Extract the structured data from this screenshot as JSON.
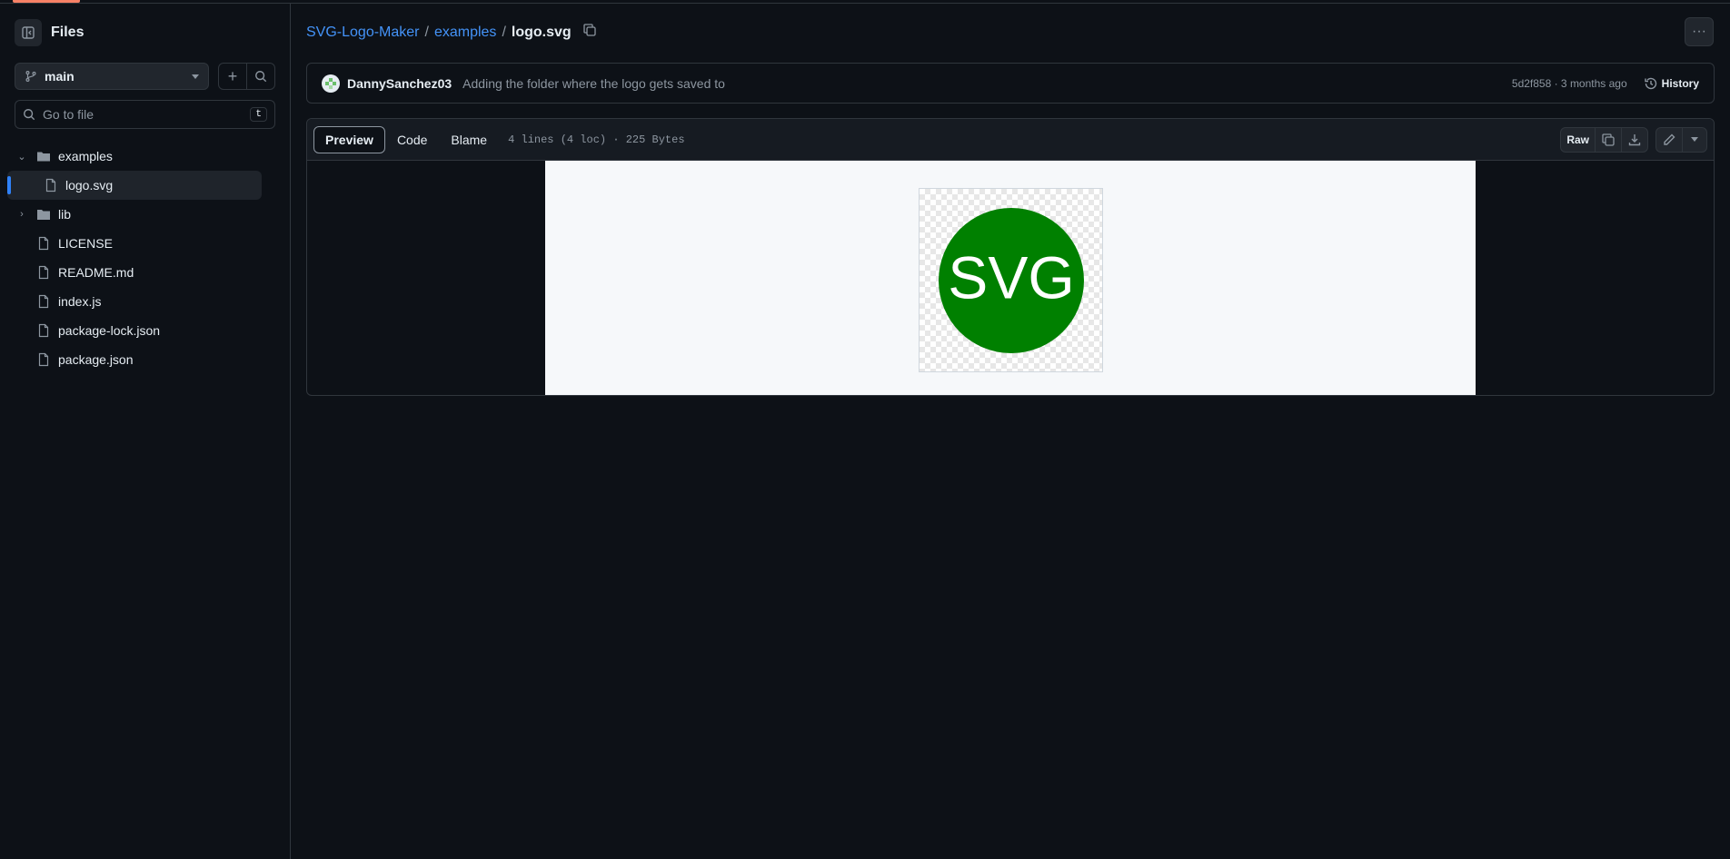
{
  "sidebar": {
    "title": "Files",
    "branch": "main",
    "goto_placeholder": "Go to file",
    "goto_shortcut": "t",
    "tree": [
      {
        "label": "examples",
        "kind": "folder",
        "expanded": true
      },
      {
        "label": "logo.svg",
        "kind": "file",
        "selected": true
      },
      {
        "label": "lib",
        "kind": "folder",
        "expanded": false
      },
      {
        "label": "LICENSE",
        "kind": "file"
      },
      {
        "label": "README.md",
        "kind": "file"
      },
      {
        "label": "index.js",
        "kind": "file"
      },
      {
        "label": "package-lock.json",
        "kind": "file"
      },
      {
        "label": "package.json",
        "kind": "file"
      }
    ]
  },
  "breadcrumb": {
    "repo": "SVG-Logo-Maker",
    "folder": "examples",
    "file": "logo.svg",
    "separator": "/"
  },
  "commit": {
    "author": "DannySanchez03",
    "message": "Adding the folder where the logo gets saved to",
    "meta": "5d2f858 · 3 months ago",
    "history_label": "History"
  },
  "file_view": {
    "tabs": [
      "Preview",
      "Code",
      "Blame"
    ],
    "active_tab": "Preview",
    "info": "4 lines (4 loc) · 225 Bytes",
    "raw_label": "Raw"
  },
  "logo": {
    "text": "SVG",
    "circle_color": "#008000",
    "text_color": "#ffffff"
  },
  "colors": {
    "accent_link": "#4493f8",
    "selected_bar": "#2f81f7",
    "tab_underline": "#f78166"
  },
  "icons": {
    "sidebar_toggle": "sidebar-collapse-icon",
    "branch": "git-branch-icon",
    "add": "plus-icon",
    "search": "search-icon",
    "copy": "copy-icon",
    "more": "kebab-horizontal-icon",
    "history": "history-icon",
    "download": "download-icon",
    "edit": "pencil-icon"
  }
}
